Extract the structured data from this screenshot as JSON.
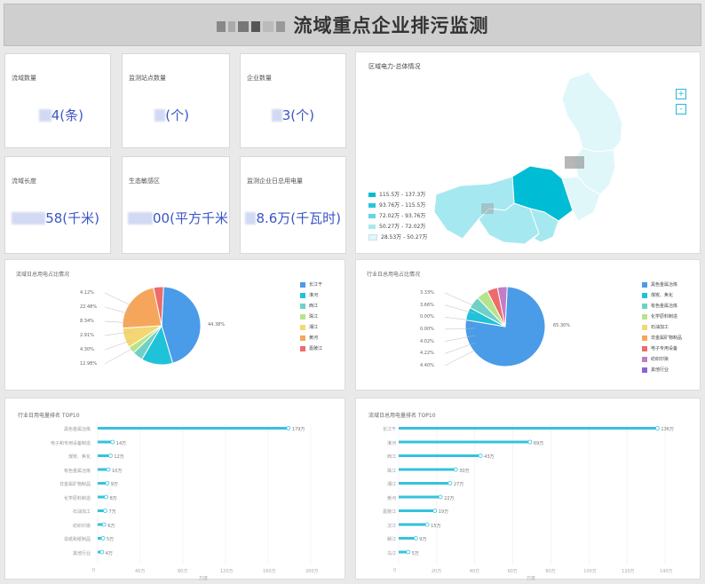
{
  "header": {
    "title": "流域重点企业排污监测"
  },
  "cards": [
    {
      "label": "流域数量",
      "value": "4(条)"
    },
    {
      "label": "监测站点数量",
      "value": "(个)"
    },
    {
      "label": "企业数量",
      "value": "3(个)"
    },
    {
      "label": "流域长度",
      "value": "58(千米)"
    },
    {
      "label": "生态敏感区",
      "value": "00(平方千米"
    },
    {
      "label": "监测企业日总用电量",
      "value": "8.6万(千瓦时)"
    }
  ],
  "map": {
    "title": "区域电力-总体情况",
    "zoom_in": "+",
    "zoom_out": "-",
    "legend": [
      {
        "label": "115.5万 - 137.3万",
        "color": "#00bcd4"
      },
      {
        "label": "93.76万 - 115.5万",
        "color": "#27c6dc"
      },
      {
        "label": "72.02万 - 93.76万",
        "color": "#63d6e6"
      },
      {
        "label": "50.27万 - 72.02万",
        "color": "#a6e8f0"
      },
      {
        "label": "28.53万 - 50.27万",
        "color": "#e0f7fa"
      }
    ]
  },
  "pie_left": {
    "title": "流域日总用电占比情况",
    "labels": [
      "4.12%",
      "22.48%",
      "8.34%",
      "2.91%",
      "4.30%",
      "12.98%",
      "44.38%"
    ],
    "legend": [
      "长江干",
      "淮河",
      "西江",
      "珠江",
      "湘江",
      "黄河",
      "嘉陵江"
    ],
    "colors": [
      "#4a9be8",
      "#1fc2d9",
      "#6fd1c6",
      "#b6e48a",
      "#f4d772",
      "#f5a65b",
      "#ee6b6b"
    ]
  },
  "pie_right": {
    "title": "行业日总用电占比情况",
    "labels": [
      "3.33%",
      "3.66%",
      "0.00%",
      "0.00%",
      "4.02%",
      "4.22%",
      "4.40%",
      "65.30%"
    ],
    "legend": [
      "黑色金属冶炼",
      "煤炭、焦化",
      "有色金属冶炼",
      "化学原料制造",
      "石油加工",
      "非金属矿物制品",
      "电子专用设备",
      "纺织印染",
      "其他行业"
    ],
    "colors": [
      "#4a9be8",
      "#1fc2d9",
      "#6fd1c6",
      "#b6e48a",
      "#f4d772",
      "#f5a65b",
      "#ee6b6b",
      "#c47cc6",
      "#8d62d6"
    ]
  },
  "bar_left": {
    "title": "行业日用电量排名 TOP10",
    "categories": [
      "黑色金属冶炼",
      "电子和专用设备制造",
      "煤炭、焦化",
      "有色金属冶炼",
      "非金属矿物制品",
      "化学原料制造",
      "石油加工",
      "纺织印染",
      "造纸和纸制品",
      "其他行业"
    ],
    "values": [
      179,
      14,
      12,
      10,
      9,
      8,
      7,
      6,
      5,
      4
    ],
    "value_labels": [
      "179万",
      "14万",
      "12万",
      "10万",
      "9万",
      "8万",
      "7万",
      "6万",
      "5万",
      "4万"
    ],
    "ticks": [
      "0",
      "40万",
      "80万",
      "120万",
      "160万",
      "200万"
    ],
    "max": 200,
    "xlabel": "万度"
  },
  "bar_right": {
    "title": "流域日总用电量排名 TOP10",
    "categories": [
      "长江干",
      "淮河",
      "西江",
      "珠江",
      "湘江",
      "黄河",
      "嘉陵江",
      "汉江",
      "赣江",
      "乌江"
    ],
    "values": [
      136,
      69,
      43,
      30,
      27,
      22,
      19,
      15,
      9,
      5
    ],
    "value_labels": [
      "136万",
      "69万",
      "43万",
      "30万",
      "27万",
      "22万",
      "19万",
      "15万",
      "9万",
      "5万"
    ],
    "ticks": [
      "0",
      "20万",
      "40万",
      "60万",
      "80万",
      "100万",
      "120万",
      "140万"
    ],
    "max": 140,
    "xlabel": "万度"
  }
}
